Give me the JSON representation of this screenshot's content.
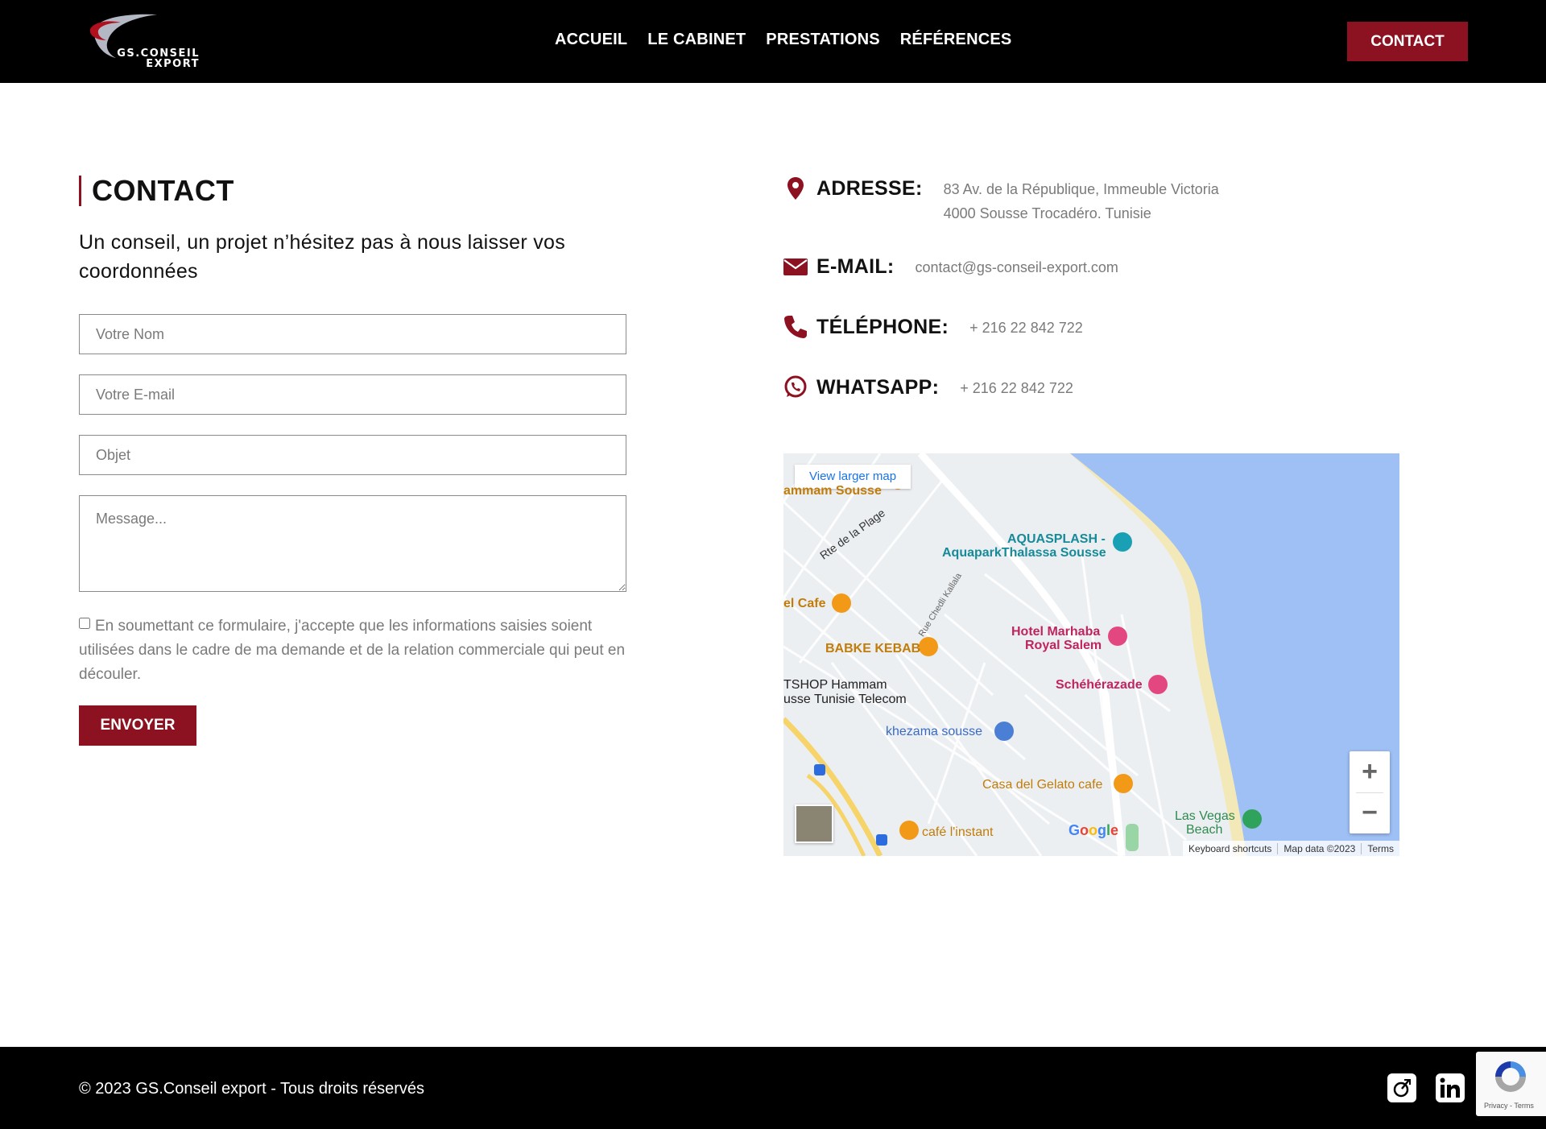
{
  "header": {
    "logo_text_line1": "GS.CONSEIL",
    "logo_text_line2": "EXPORT",
    "nav": [
      "ACCUEIL",
      "LE CABINET",
      "PRESTATIONS",
      "RÉFÉRENCES"
    ],
    "contact_label": "CONTACT"
  },
  "form": {
    "title": "CONTACT",
    "subtitle": "Un conseil, un projet n’hésitez pas à nous laisser vos coordonnées",
    "name_placeholder": "Votre Nom",
    "email_placeholder": "Votre E-mail",
    "subject_placeholder": "Objet",
    "message_placeholder": "Message...",
    "consent_text": "En soumettant ce formulaire, j'accepte que les informations saisies soient utilisées dans le cadre de ma demande et de la relation commerciale qui peut en découler.",
    "send_label": "ENVOYER"
  },
  "info": {
    "address_label": "ADRESSE:",
    "address_line1": "83 Av. de la République, Immeuble Victoria",
    "address_line2": "4000 Sousse Trocadéro. Tunisie",
    "email_label": "E-MAIL:",
    "email_value": "contact@gs-conseil-export.com",
    "phone_label": "TÉLÉPHONE:",
    "phone_value": "+ 216 22 842 722",
    "whatsapp_label": "WHATSAPP:",
    "whatsapp_value": "+ 216 22 842 722"
  },
  "map": {
    "larger_map_link": "View larger map",
    "pois": {
      "hammam": "ammam Sousse",
      "road_plage": "Rte de la Plage",
      "aquasplash_1": "AQUASPLASH -",
      "aquasplash_2": "AquaparkThalassa Sousse",
      "cafe": "el Cafe",
      "rue_chedli": "Rue Chedli Kallala",
      "marhaba_1": "Hotel Marhaba",
      "marhaba_2": "Royal Salem",
      "babke": "BABKE KEBAB",
      "scheherazade": "Schéhérazade",
      "tshop_1": "TSHOP Hammam",
      "tshop_2": "usse Tunisie Telecom",
      "khezama": "khezama sousse",
      "casa": "Casa del Gelato cafe",
      "las_vegas_1": "Las Vegas",
      "las_vegas_2": "Beach",
      "instant": "café l'instant"
    },
    "google_logo": "Google",
    "footer_shortcuts": "Keyboard shortcuts",
    "footer_data": "Map data ©2023",
    "footer_terms": "Terms",
    "colors": {
      "water": "#9ec0f5",
      "land": "#eceff2",
      "road": "#ffffff",
      "highway": "#f6d46a"
    }
  },
  "footer": {
    "copyright": "© 2023 GS.Conseil export - Tous droits réservés",
    "social_icons": [
      "custom-logo-icon",
      "linkedin-icon"
    ],
    "recaptcha_text": "Privacy - Terms"
  },
  "colors": {
    "brand": "#8d1221",
    "header_bg": "#000000",
    "text_muted": "#7a7a7a"
  }
}
